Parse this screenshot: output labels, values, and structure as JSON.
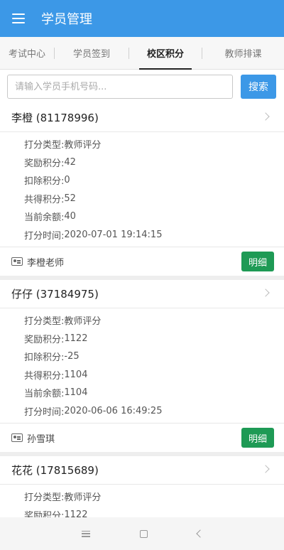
{
  "app": {
    "title": "学员管理",
    "menu_icon": "menu-icon"
  },
  "tabs": [
    {
      "label": "考试中心",
      "active": false
    },
    {
      "label": "学员签到",
      "active": false
    },
    {
      "label": "校区积分",
      "active": true
    },
    {
      "label": "教师排课",
      "active": false
    }
  ],
  "search": {
    "placeholder": "请输入学员手机号码...",
    "value": "",
    "button_label": "搜索"
  },
  "labels": {
    "type": "打分类型:",
    "reward": "奖励积分:",
    "deduct": "扣除积分:",
    "total": "共得积分:",
    "balance": "当前余额:",
    "time": "打分时间:",
    "detail_button": "明细"
  },
  "records": [
    {
      "name_line": "李橙  (81178996)",
      "type": "教师评分",
      "reward": "42",
      "deduct": "0",
      "total": "52",
      "balance": "40",
      "time": "2020-07-01 19:14:15",
      "teacher": "李橙老师"
    },
    {
      "name_line": "仔仔  (37184975)",
      "type": "教师评分",
      "reward": "1122",
      "deduct": "-25",
      "total": "1104",
      "balance": "1104",
      "time": "2020-06-06 16:49:25",
      "teacher": "孙雪琪"
    },
    {
      "name_line": "花花  (17815689)",
      "type": "教师评分",
      "reward": "1122"
    }
  ],
  "colors": {
    "primary": "#3c98e7",
    "detail_button": "#1e9a55"
  }
}
